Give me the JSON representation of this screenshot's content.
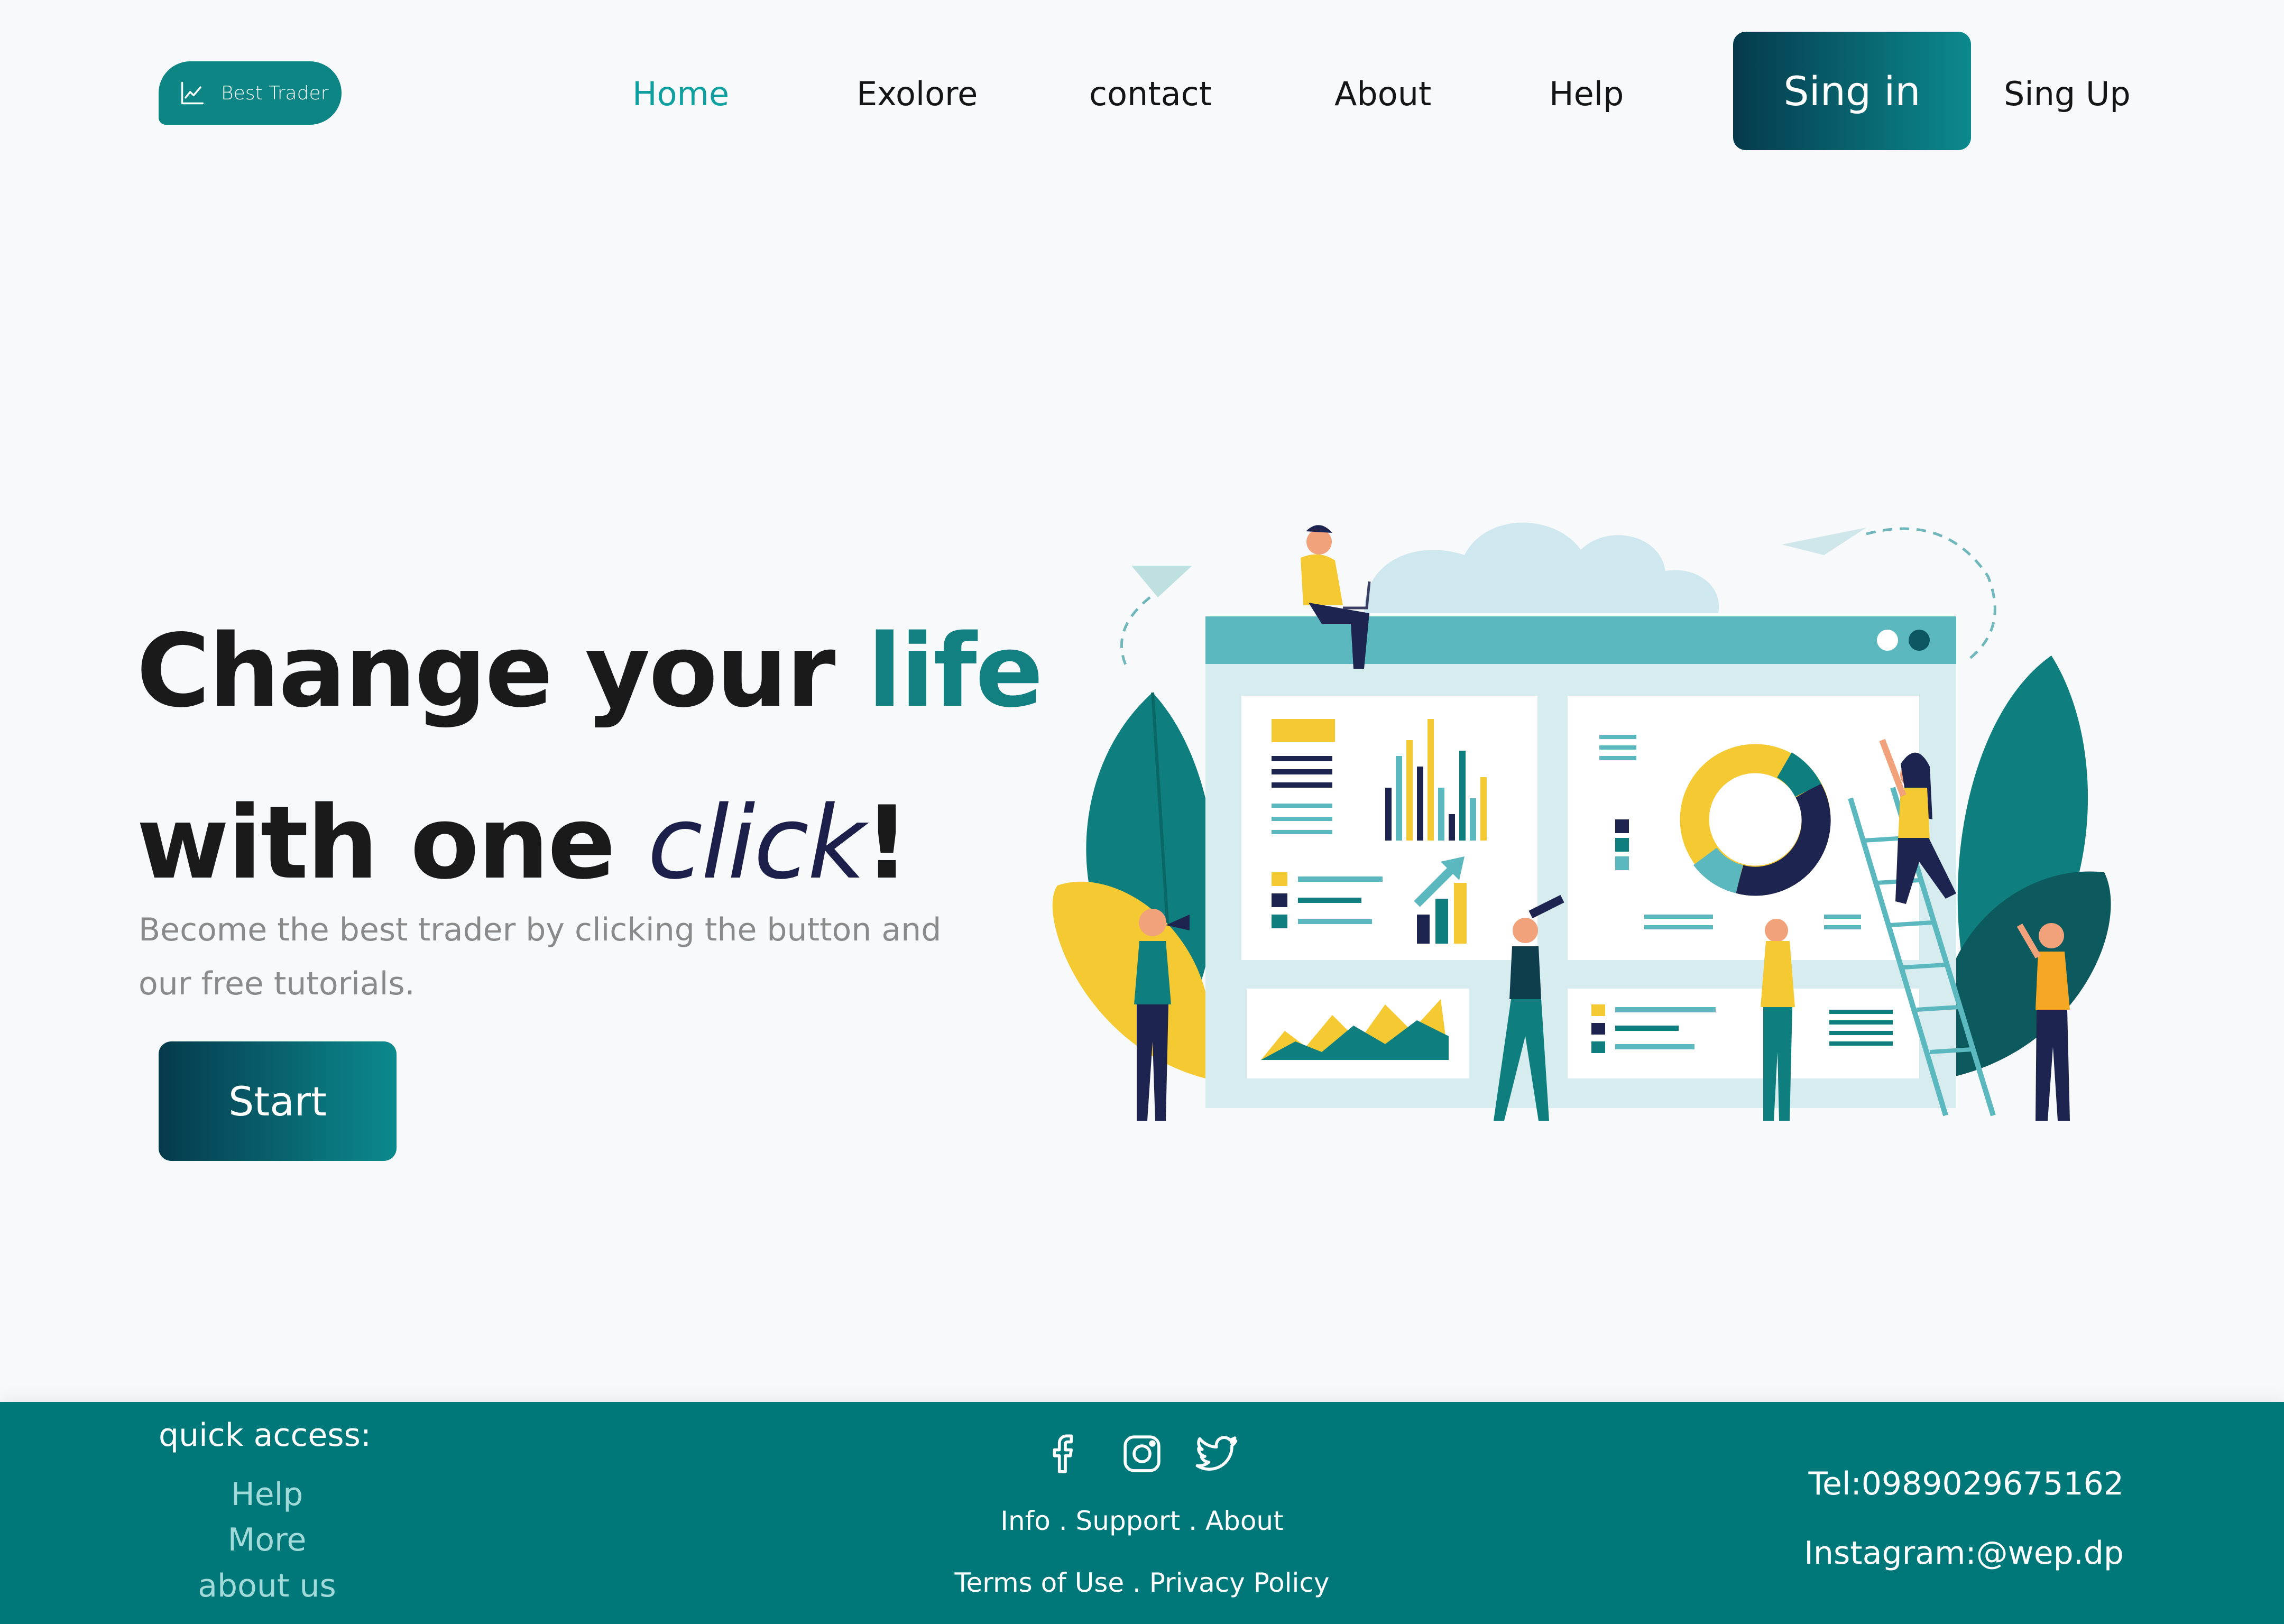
{
  "header": {
    "logo_text": "Best Trader",
    "nav": [
      "Home",
      "Exolore",
      "contact",
      "About",
      "Help"
    ],
    "active_nav": "Home",
    "signin_label": "Sing in",
    "signup_label": "Sing Up"
  },
  "hero": {
    "line1_part1": "Change your ",
    "line1_accent": "life",
    "line2_part1": "with one ",
    "line2_italic": "click",
    "line2_end": "!",
    "subtitle": "Become the best trader by clicking the button and our free tutorials.",
    "start_label": "Start"
  },
  "footer": {
    "quick_access_title": "quick access:",
    "quick_links": [
      "Help",
      "More",
      "about us"
    ],
    "social_icons": [
      "facebook-icon",
      "instagram-icon",
      "twitter-icon"
    ],
    "links_row1": "Info . Support . About",
    "links_row2": "Terms of Use . Privacy Policy",
    "tel": "Tel:0989029675162",
    "instagram": "Instagram:@wep.dp"
  },
  "colors": {
    "brand_teal": "#127f80",
    "footer_bg": "#00787a",
    "button_gradient_start": "#053a4c",
    "button_gradient_end": "#0b8a8e",
    "active_nav": "#11a0a0",
    "accent_yellow": "#f5c932"
  }
}
